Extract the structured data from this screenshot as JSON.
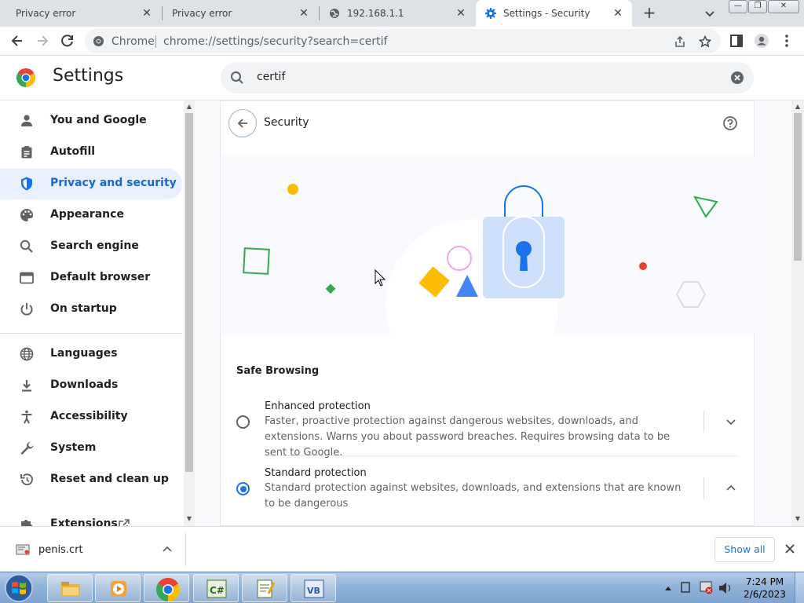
{
  "tabs": [
    {
      "title": "Privacy error",
      "close": "✕"
    },
    {
      "title": "Privacy error",
      "close": "✕"
    },
    {
      "title": "192.168.1.1",
      "close": "✕"
    },
    {
      "title": "Settings - Security",
      "close": "✕",
      "active": true
    }
  ],
  "tabstrip": {
    "new_tab": "+"
  },
  "window_controls": {
    "minimize": "—",
    "restore": "❐",
    "close": "✕"
  },
  "omnibox": {
    "site_label": "Chrome",
    "url": "chrome://settings/security?search=certif"
  },
  "settings": {
    "title": "Settings",
    "search_value": "certif"
  },
  "sidebar": {
    "items": [
      {
        "label": "You and Google",
        "icon": "person-icon"
      },
      {
        "label": "Autofill",
        "icon": "clipboard-icon"
      },
      {
        "label": "Privacy and security",
        "icon": "shield-icon",
        "active": true
      },
      {
        "label": "Appearance",
        "icon": "palette-icon"
      },
      {
        "label": "Search engine",
        "icon": "search-icon"
      },
      {
        "label": "Default browser",
        "icon": "browser-icon"
      },
      {
        "label": "On startup",
        "icon": "power-icon"
      },
      {
        "label": "Languages",
        "icon": "globe-icon"
      },
      {
        "label": "Downloads",
        "icon": "download-icon"
      },
      {
        "label": "Accessibility",
        "icon": "accessibility-icon"
      },
      {
        "label": "System",
        "icon": "wrench-icon"
      },
      {
        "label": "Reset and clean up",
        "icon": "reset-icon"
      },
      {
        "label": "Extensions",
        "icon": "puzzle-icon"
      }
    ]
  },
  "security": {
    "page_title": "Security",
    "section_label": "Safe Browsing",
    "options": [
      {
        "title": "Enhanced protection",
        "description": "Faster, proactive protection against dangerous websites, downloads, and extensions. Warns you about password breaches. Requires browsing data to be sent to Google.",
        "selected": false,
        "expanded": false
      },
      {
        "title": "Standard protection",
        "description": "Standard protection against websites, downloads, and extensions that are known to be dangerous",
        "selected": true,
        "expanded": true
      }
    ]
  },
  "download_bar": {
    "filename": "penis.crt",
    "show_all": "Show all"
  },
  "taskbar": {
    "time": "7:24 PM",
    "date": "2/6/2023"
  },
  "colors": {
    "accent": "#1a73e8",
    "active_nav_bg": "#e8f0fe",
    "active_nav_text": "#1967d2"
  }
}
